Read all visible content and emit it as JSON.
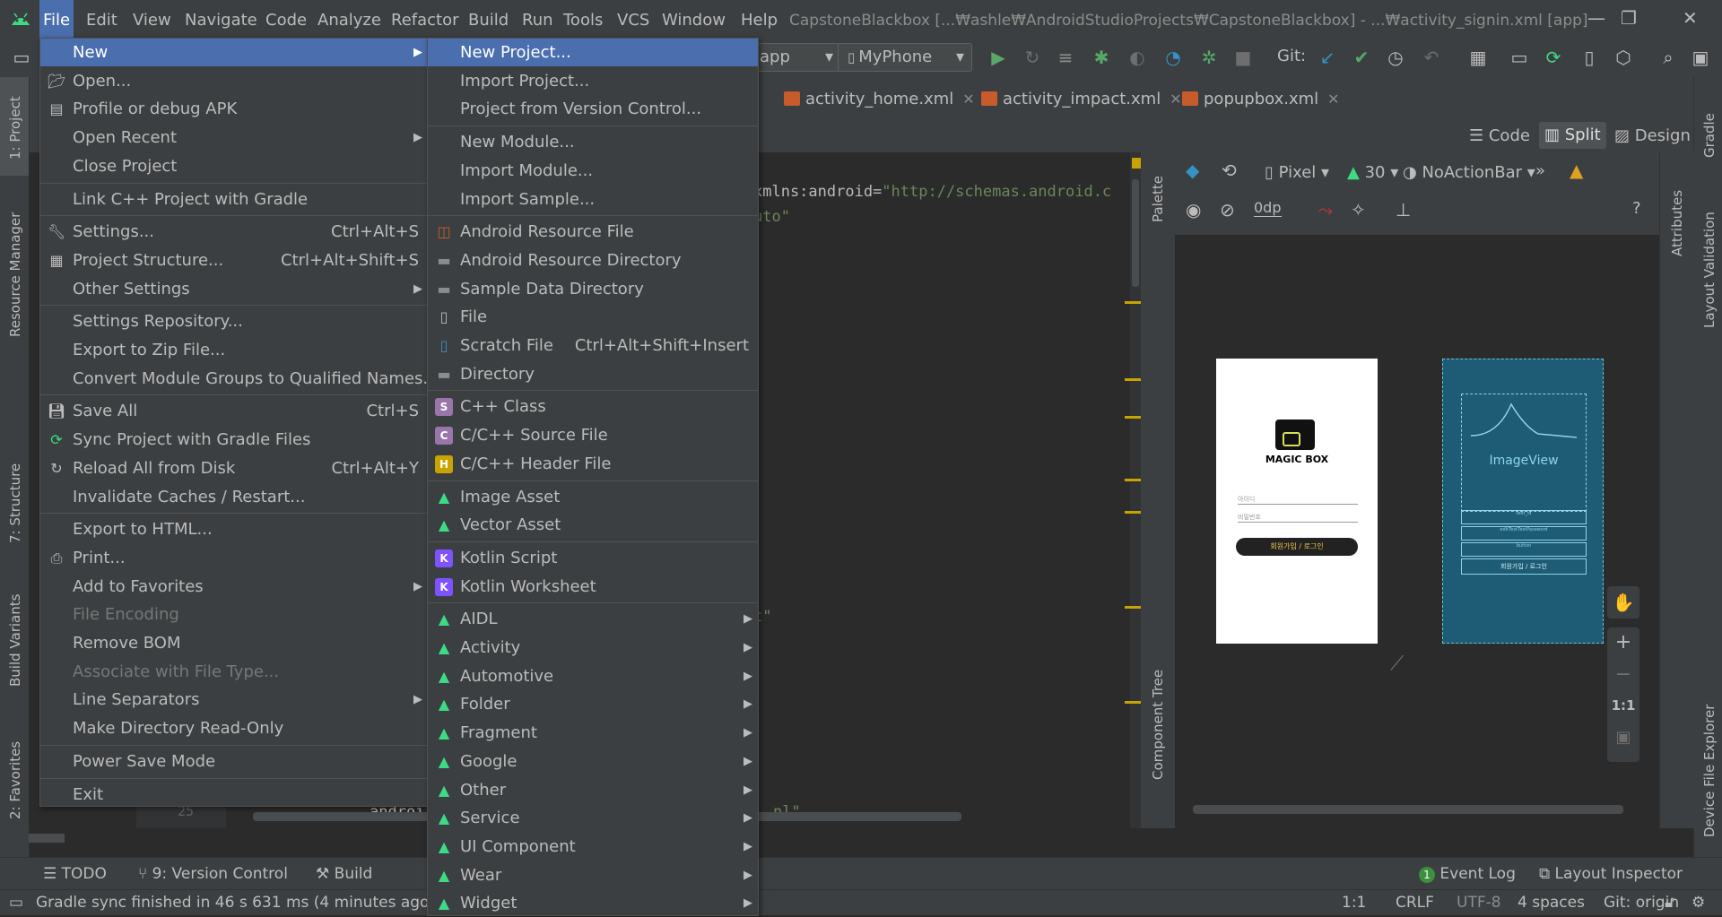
{
  "menubar": {
    "items": [
      {
        "label": "File",
        "active": true
      },
      {
        "label": "Edit"
      },
      {
        "label": "View"
      },
      {
        "label": "Navigate"
      },
      {
        "label": "Code"
      },
      {
        "label": "Analyze"
      },
      {
        "label": "Refactor"
      },
      {
        "label": "Build"
      },
      {
        "label": "Run"
      },
      {
        "label": "Tools"
      },
      {
        "label": "VCS"
      },
      {
        "label": "Window"
      },
      {
        "label": "Help"
      }
    ],
    "title": "CapstoneBlackbox [...₩ashle₩AndroidStudioProjects₩CapstoneBlackbox] - ...₩activity_signin.xml [app]"
  },
  "toolbar": {
    "module_combo": "app",
    "device_combo": "MyPhone",
    "git_label": "Git:"
  },
  "editor_tabs": [
    {
      "label": "activity_home.xml"
    },
    {
      "label": "activity_impact.xml"
    },
    {
      "label": "popupbox.xml"
    }
  ],
  "view_modes": {
    "code": "Code",
    "split": "Split",
    "design": "Design"
  },
  "code_lines": {
    "l1_attr": "xmlns:android=",
    "l1_val": "\"http://schemas.android.c",
    "l2": "uto\"",
    "l3": "t\"",
    "line_number": "25",
    "l4": "androi",
    "l4_end": "nl\""
  },
  "design_toolbar": {
    "device": "Pixel",
    "api": "30",
    "theme": "NoActionBar",
    "margin": "0dp"
  },
  "preview": {
    "app_title": "MAGIC BOX",
    "id_hint": "아이디",
    "pw_hint": "비밀번호",
    "button": "회원가입 / 로그인",
    "blueprint_image": "ImageView",
    "bp_line1": "text_id",
    "bp_line2": "editTextTextPassword",
    "bp_line3": "button",
    "bp_button": "회원가입 / 로그인"
  },
  "zoom_controls": {
    "one_to_one": "1:1",
    "plus": "+",
    "minus": "−"
  },
  "left_strip": {
    "project": "1: Project",
    "resource": "Resource Manager",
    "structure": "7: Structure",
    "variants": "Build Variants",
    "favorites": "2: Favorites"
  },
  "right_strip": {
    "gradle": "Gradle",
    "layout_validation": "Layout Validation",
    "device_explorer": "Device File Explorer",
    "attributes": "Attributes",
    "palette": "Palette",
    "component_tree": "Component Tree"
  },
  "bottom_tools": [
    {
      "label": "TODO"
    },
    {
      "label": "9: Version Control"
    },
    {
      "label": "Build"
    },
    {
      "label": "Event Log"
    },
    {
      "label": "Layout Inspector"
    }
  ],
  "status": {
    "message": "Gradle sync finished in 46 s 631 ms (4 minutes ago)",
    "position": "1:1",
    "line_sep": "CRLF",
    "encoding": "UTF-8",
    "indent": "4 spaces",
    "git": "Git: origin"
  },
  "file_menu": [
    {
      "label": "New",
      "submenu": true,
      "selected": true
    },
    {
      "label": "Open...",
      "icon": "folder-open-icon"
    },
    {
      "label": "Profile or debug APK",
      "icon": "apk-icon"
    },
    {
      "label": "Open Recent",
      "submenu": true
    },
    {
      "label": "Close Project"
    },
    {
      "sep": true
    },
    {
      "label": "Link C++ Project with Gradle"
    },
    {
      "sep": true
    },
    {
      "label": "Settings...",
      "shortcut": "Ctrl+Alt+S",
      "icon": "wrench-icon"
    },
    {
      "label": "Project Structure...",
      "shortcut": "Ctrl+Alt+Shift+S",
      "icon": "project-structure-icon"
    },
    {
      "label": "Other Settings",
      "submenu": true
    },
    {
      "sep": true
    },
    {
      "label": "Settings Repository..."
    },
    {
      "label": "Export to Zip File..."
    },
    {
      "label": "Convert Module Groups to Qualified Names..."
    },
    {
      "sep": true
    },
    {
      "label": "Save All",
      "shortcut": "Ctrl+S",
      "icon": "save-icon"
    },
    {
      "label": "Sync Project with Gradle Files",
      "icon": "gradle-sync-icon"
    },
    {
      "label": "Reload All from Disk",
      "shortcut": "Ctrl+Alt+Y",
      "icon": "reload-icon"
    },
    {
      "label": "Invalidate Caches / Restart..."
    },
    {
      "sep": true
    },
    {
      "label": "Export to HTML..."
    },
    {
      "label": "Print...",
      "icon": "print-icon"
    },
    {
      "label": "Add to Favorites",
      "submenu": true
    },
    {
      "label": "File Encoding",
      "disabled": true
    },
    {
      "label": "Remove BOM"
    },
    {
      "label": "Associate with File Type...",
      "disabled": true
    },
    {
      "label": "Line Separators",
      "submenu": true
    },
    {
      "label": "Make Directory Read-Only"
    },
    {
      "sep": true
    },
    {
      "label": "Power Save Mode"
    },
    {
      "sep": true
    },
    {
      "label": "Exit"
    }
  ],
  "new_menu": [
    {
      "label": "New Project...",
      "selected": true
    },
    {
      "label": "Import Project..."
    },
    {
      "label": "Project from Version Control..."
    },
    {
      "sep": true
    },
    {
      "label": "New Module..."
    },
    {
      "label": "Import Module..."
    },
    {
      "label": "Import Sample..."
    },
    {
      "sep": true
    },
    {
      "label": "Android Resource File",
      "icon": "xml-resource-icon"
    },
    {
      "label": "Android Resource Directory",
      "icon": "folder-icon"
    },
    {
      "label": "Sample Data Directory",
      "icon": "folder-icon"
    },
    {
      "label": "File",
      "icon": "file-icon"
    },
    {
      "label": "Scratch File",
      "shortcut": "Ctrl+Alt+Shift+Insert",
      "icon": "scratch-file-icon"
    },
    {
      "label": "Directory",
      "icon": "folder-icon"
    },
    {
      "sep": true
    },
    {
      "label": "C++ Class",
      "icon": "cpp-class-icon"
    },
    {
      "label": "C/C++ Source File",
      "icon": "cpp-source-icon"
    },
    {
      "label": "C/C++ Header File",
      "icon": "cpp-header-icon"
    },
    {
      "sep": true
    },
    {
      "label": "Image Asset",
      "icon": "android-icon"
    },
    {
      "label": "Vector Asset",
      "icon": "android-icon"
    },
    {
      "sep": true
    },
    {
      "label": "Kotlin Script",
      "icon": "kotlin-script-icon"
    },
    {
      "label": "Kotlin Worksheet",
      "icon": "kotlin-worksheet-icon"
    },
    {
      "sep": true
    },
    {
      "label": "AIDL",
      "submenu": true,
      "icon": "android-icon"
    },
    {
      "label": "Activity",
      "submenu": true,
      "icon": "android-icon"
    },
    {
      "label": "Automotive",
      "submenu": true,
      "icon": "android-icon"
    },
    {
      "label": "Folder",
      "submenu": true,
      "icon": "android-icon"
    },
    {
      "label": "Fragment",
      "submenu": true,
      "icon": "android-icon"
    },
    {
      "label": "Google",
      "submenu": true,
      "icon": "android-icon"
    },
    {
      "label": "Other",
      "submenu": true,
      "icon": "android-icon"
    },
    {
      "label": "Service",
      "submenu": true,
      "icon": "android-icon"
    },
    {
      "label": "UI Component",
      "submenu": true,
      "icon": "android-icon"
    },
    {
      "label": "Wear",
      "submenu": true,
      "icon": "android-icon"
    },
    {
      "label": "Widget",
      "submenu": true,
      "icon": "android-icon"
    }
  ],
  "colors": {
    "accent": "#4b6eaf",
    "android_green": "#3ddc84",
    "panel": "#3c3f41",
    "editor": "#2b2b2b"
  }
}
